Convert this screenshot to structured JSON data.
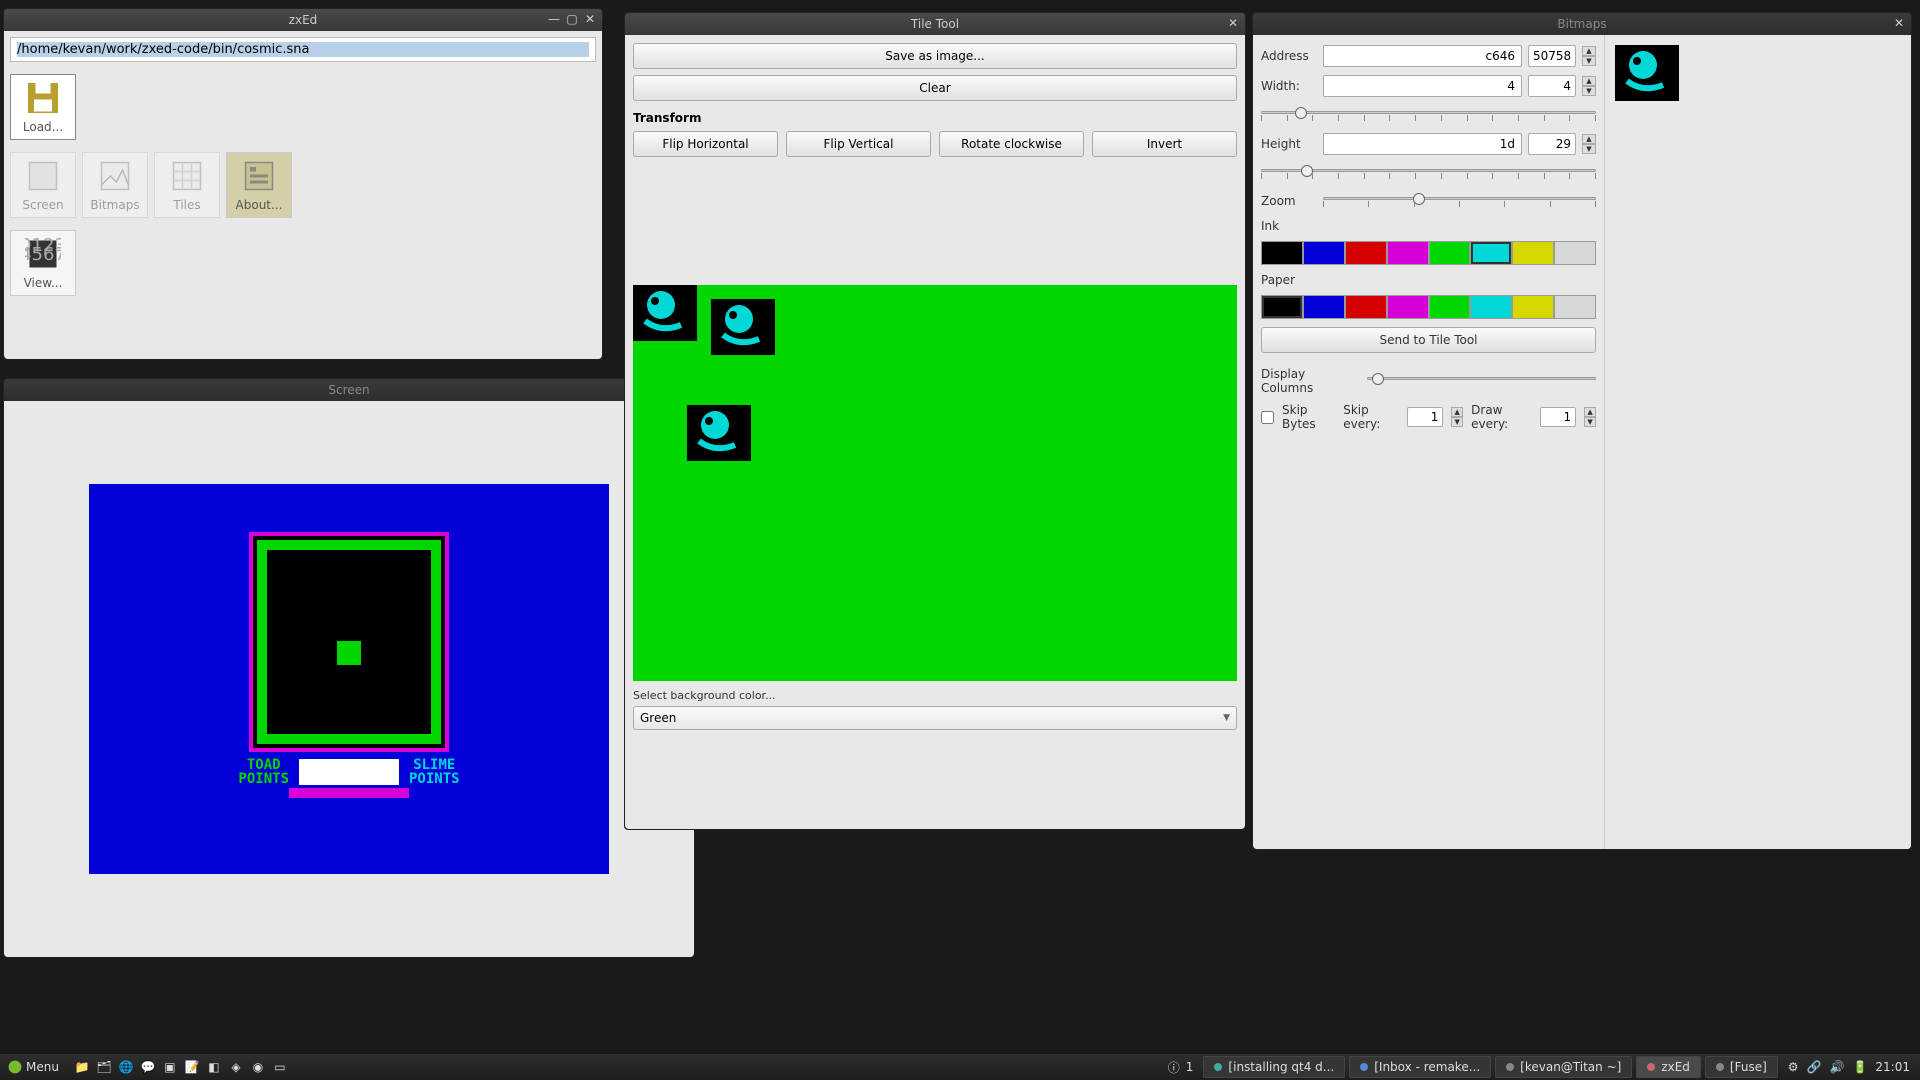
{
  "zxed": {
    "title": "zxEd",
    "path": "/home/kevan/work/zxed-code/bin/cosmic.sna",
    "buttons": {
      "load": "Load...",
      "screen": "Screen",
      "bitmaps": "Bitmaps",
      "tiles": "Tiles",
      "about": "About...",
      "view": "View..."
    }
  },
  "screen": {
    "title": "Screen",
    "toad_label": "TOAD\nPOINTS",
    "slime_label": "SLIME\nPOINTS"
  },
  "tile": {
    "title": "Tile Tool",
    "save": "Save as image...",
    "clear": "Clear",
    "transform_label": "Transform",
    "flip_h": "Flip Horizontal",
    "flip_v": "Flip Vertical",
    "rotate": "Rotate clockwise",
    "invert": "Invert",
    "bg_label": "Select background color...",
    "bg_value": "Green"
  },
  "bitmaps": {
    "title": "Bitmaps",
    "address_label": "Address",
    "address_hex": "c646",
    "address_dec": "50758",
    "width_label": "Width:",
    "width_hex": "4",
    "width_dec": "4",
    "height_label": "Height",
    "height_hex": "1d",
    "height_dec": "29",
    "zoom_label": "Zoom",
    "ink_label": "Ink",
    "paper_label": "Paper",
    "send": "Send to Tile Tool",
    "display_cols_label": "Display Columns",
    "skip_bytes_label": "Skip Bytes",
    "skip_every_label": "Skip every:",
    "skip_every_val": "1",
    "draw_every_label": "Draw every:",
    "draw_every_val": "1",
    "colors": [
      "#000000",
      "#0000d7",
      "#d70000",
      "#d700d7",
      "#00d700",
      "#00d7d7",
      "#d7d700",
      "#d7d7d7"
    ],
    "ink_selected": 5,
    "paper_selected": 0
  },
  "taskbar": {
    "menu": "Menu",
    "workspace": "1",
    "tasks": [
      {
        "label": "[installing qt4 d...",
        "color": "#4a9"
      },
      {
        "label": "[Inbox - remake...",
        "color": "#58c"
      },
      {
        "label": "[kevan@Titan ~]",
        "color": "#888"
      },
      {
        "label": "zxEd",
        "color": "#c66",
        "active": true
      },
      {
        "label": "[Fuse]",
        "color": "#888"
      }
    ],
    "clock": "21:01"
  }
}
